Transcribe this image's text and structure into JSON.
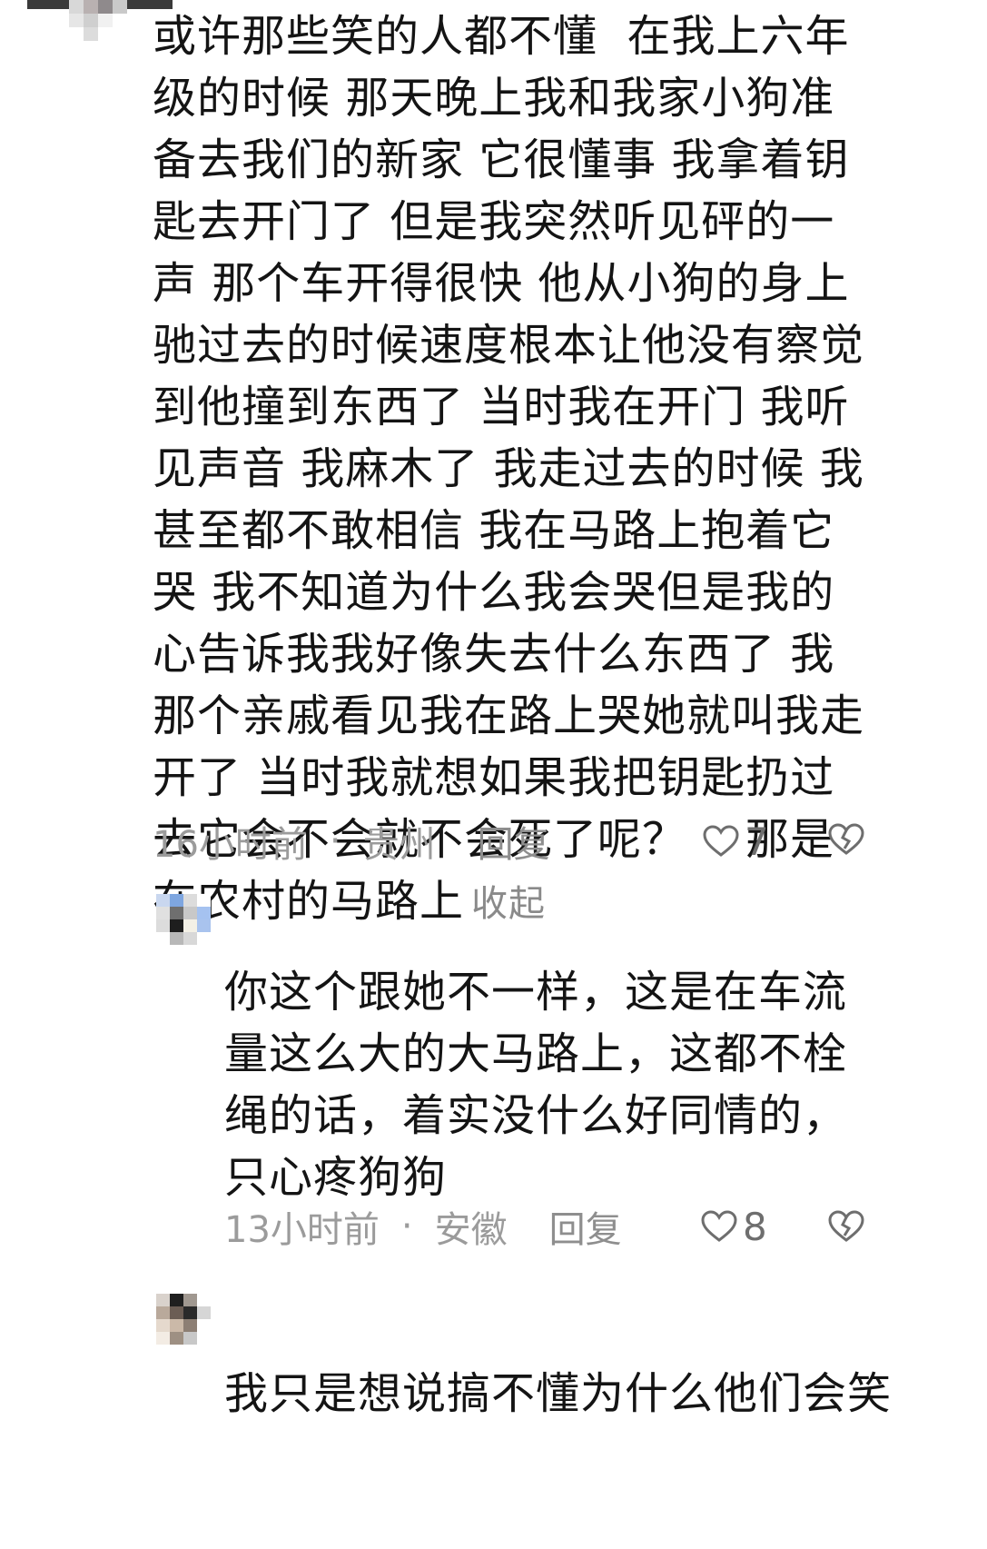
{
  "comments": [
    {
      "text": "或许那些笑的人都不懂  在我上六年级的时候 那天晚上我和我家小狗准备去我们的新家 它很懂事 我拿着钥匙去开门了 但是我突然听见砰的一声 那个车开得很快 他从小狗的身上驰过去的时候速度根本让他没有察觉到他撞到东西了 当时我在开门 我听见声音 我麻木了 我走过去的时候 我甚至都不敢相信 我在马路上抱着它哭 我不知道为什么我会哭但是我的心告诉我我好像失去什么东西了 我那个亲戚看见我在路上哭她就叫我走开了 当时我就想如果我把钥匙扔过去它会不会就不会死了呢？    那是在农村的马路上",
      "collapse_label": "收起",
      "time": "16小时前",
      "separator": "·",
      "location": "贵州",
      "reply_label": "回复",
      "likes": "7"
    },
    {
      "text": "你这个跟她不一样，这是在车流量这么大的大马路上，这都不栓绳的话，着实没什么好同情的，只心疼狗狗",
      "time": "13小时前",
      "separator": "·",
      "location": "安徽",
      "reply_label": "回复",
      "likes": "8"
    },
    {
      "text": "我只是想说搞不懂为什么他们会笑"
    }
  ],
  "icons": {
    "like": "heart-outline-icon",
    "dislike": "broken-heart-icon"
  },
  "colors": {
    "text": "#141414",
    "meta": "#9b9b9b",
    "icon": "#6e6e6e"
  }
}
